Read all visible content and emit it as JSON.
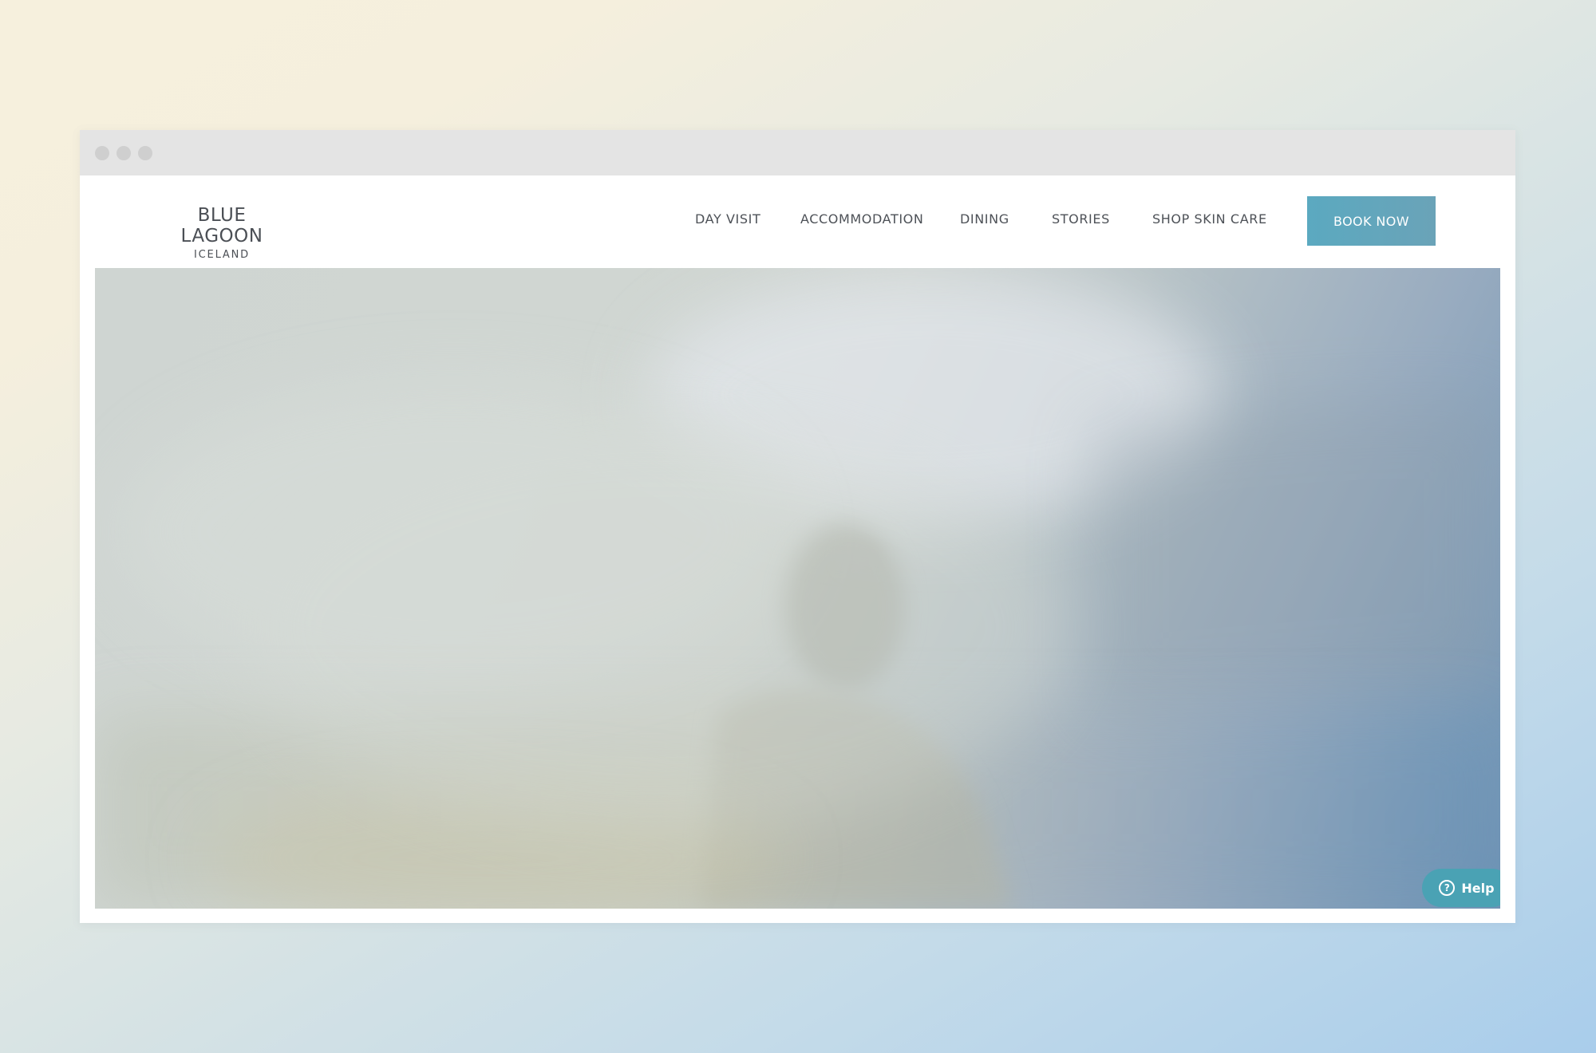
{
  "brand": {
    "name": "BLUE LAGOON",
    "subtitle": "ICELAND"
  },
  "nav": {
    "items": [
      {
        "label": "DAY VISIT"
      },
      {
        "label": "ACCOMMODATION"
      },
      {
        "label": "DINING"
      },
      {
        "label": "STORIES"
      },
      {
        "label": "SHOP SKIN CARE"
      }
    ],
    "cta_label": "BOOK NOW"
  },
  "hero": {
    "image": "misty-lagoon-bather-photo"
  },
  "help": {
    "label": "Help",
    "icon": "question-circle-icon",
    "icon_glyph": "?"
  },
  "colors": {
    "cta": "#5ba9c0",
    "help": "#4aa2b4",
    "text": "#4d5157"
  }
}
